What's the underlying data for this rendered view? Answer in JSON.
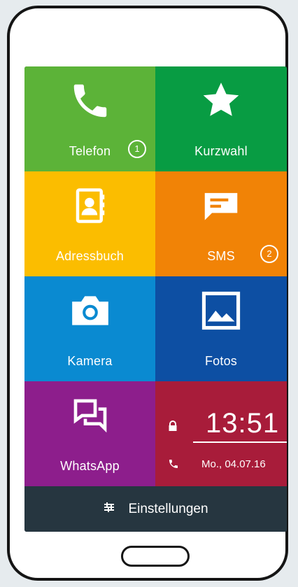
{
  "tiles": {
    "telefon": {
      "label": "Telefon",
      "badge": "1",
      "icon": "phone-icon",
      "color": "#5cb338"
    },
    "kurzwahl": {
      "label": "Kurzwahl",
      "icon": "star-icon",
      "color": "#089c43"
    },
    "adressbuch": {
      "label": "Adressbuch",
      "icon": "contact-book-icon",
      "color": "#fbbd00"
    },
    "sms": {
      "label": "SMS",
      "badge": "2",
      "icon": "message-icon",
      "color": "#f18306"
    },
    "kamera": {
      "label": "Kamera",
      "icon": "camera-icon",
      "color": "#0a8ad1"
    },
    "fotos": {
      "label": "Fotos",
      "icon": "image-icon",
      "color": "#0d4fa3"
    },
    "whatsapp": {
      "label": "WhatsApp",
      "icon": "chat-icon",
      "color": "#8d1e8c"
    }
  },
  "clock": {
    "time": "13:51",
    "date": "Mo., 04.07.16",
    "color": "#a81c3a"
  },
  "settings": {
    "label": "Einstellungen",
    "icon": "sliders-icon"
  }
}
